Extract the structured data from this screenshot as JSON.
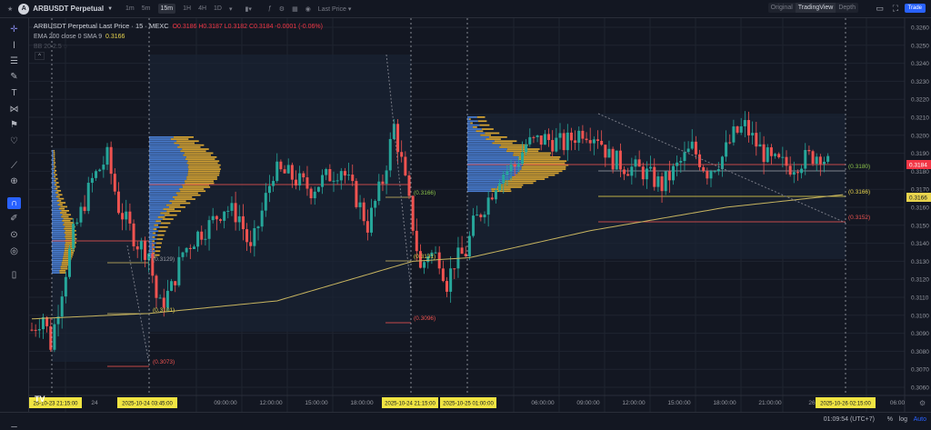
{
  "header": {
    "symbol": "ARBUSDT Perpetual",
    "intervals": [
      "1m",
      "5m",
      "15m",
      "1H",
      "4H",
      "1D"
    ],
    "selected_interval": "15m",
    "price_type": "Last Price ▾",
    "view_tabs": [
      "Original",
      "TradingView",
      "Depth"
    ],
    "selected_view": "TradingView",
    "trade_label": "Trade"
  },
  "legend": {
    "title": "ARBUSDT Perpetual Last Price · 15 · MEXC",
    "ohlc": "O0.3186 H0.3187 L0.3182 C0.3184 -0.0001 (-0.06%)",
    "ema_label": "EMA 200 close 0 SMA 9",
    "ema_value": "0.3166",
    "bb_label": "BB 20 2.5"
  },
  "price_axis": {
    "ticks": [
      "0.3260",
      "0.3250",
      "0.3240",
      "0.3230",
      "0.3220",
      "0.3210",
      "0.3200",
      "0.3190",
      "0.3180",
      "0.3170",
      "0.3160",
      "0.3150",
      "0.3140",
      "0.3130",
      "0.3120",
      "0.3110",
      "0.3100",
      "0.3090",
      "0.3080",
      "0.3070",
      "0.3060"
    ],
    "last_price": "0.3184",
    "ema_price": "0.3166",
    "last_color": "#f23645",
    "ema_color": "#e8d44d"
  },
  "time_axis": {
    "labels": [
      "24",
      "09:00:00",
      "12:00:00",
      "15:00:00",
      "18:00:00",
      "06:00:00",
      "09:00:00",
      "12:00:00",
      "15:00:00",
      "18:00:00",
      "21:00:00",
      "26",
      "06:00"
    ],
    "highlights": [
      "25-10-23  21:15:00",
      "2025-10-24  03:45:00",
      "2025-10-24  21:15:00",
      "2025-10-25  01:00:00",
      "2025-10-26  02:15:00"
    ]
  },
  "annotations": [
    "(0.3073)",
    "(0.3101)",
    "(0.3129)",
    "(0.3166)",
    "(0.3131)",
    "(0.3096)",
    "(0.3180)",
    "(0.3166)",
    "(0.3152)"
  ],
  "footer": {
    "clock": "01:09:54 (UTC+7)",
    "percent": "%",
    "log": "log",
    "auto": "Auto"
  },
  "colors": {
    "up": "#26a69a",
    "down": "#ef5350",
    "buy": "#4a7fd4",
    "sell": "#d9a632",
    "ema": "#c8b560"
  },
  "chart_data": {
    "type": "candlestick",
    "price_path": [
      [
        0,
        0.3092
      ],
      [
        3,
        0.31
      ],
      [
        5,
        0.3084
      ],
      [
        8,
        0.3115
      ],
      [
        11,
        0.3145
      ],
      [
        16,
        0.3175
      ],
      [
        20,
        0.3188
      ],
      [
        23,
        0.316
      ],
      [
        28,
        0.314
      ],
      [
        31,
        0.3135
      ],
      [
        33,
        0.311
      ],
      [
        34,
        0.3105
      ],
      [
        37,
        0.3115
      ],
      [
        40,
        0.3135
      ],
      [
        44,
        0.3145
      ],
      [
        47,
        0.315
      ],
      [
        51,
        0.316
      ],
      [
        55,
        0.3155
      ],
      [
        58,
        0.3135
      ],
      [
        62,
        0.3165
      ],
      [
        64,
        0.318
      ],
      [
        68,
        0.3178
      ],
      [
        74,
        0.317
      ],
      [
        77,
        0.3175
      ],
      [
        82,
        0.3182
      ],
      [
        86,
        0.3165
      ],
      [
        89,
        0.315
      ],
      [
        93,
        0.3175
      ],
      [
        96,
        0.3205
      ],
      [
        98,
        0.3185
      ],
      [
        101,
        0.315
      ],
      [
        103,
        0.3125
      ],
      [
        105,
        0.3135
      ],
      [
        108,
        0.3132
      ],
      [
        110,
        0.3118
      ],
      [
        112,
        0.313
      ],
      [
        115,
        0.3135
      ],
      [
        117,
        0.315
      ],
      [
        121,
        0.3165
      ],
      [
        124,
        0.3178
      ],
      [
        128,
        0.3183
      ],
      [
        131,
        0.3195
      ],
      [
        136,
        0.3198
      ],
      [
        141,
        0.3195
      ],
      [
        146,
        0.3203
      ],
      [
        150,
        0.32
      ],
      [
        153,
        0.3188
      ],
      [
        157,
        0.3183
      ],
      [
        162,
        0.318
      ],
      [
        167,
        0.3172
      ],
      [
        172,
        0.3185
      ],
      [
        175,
        0.3193
      ],
      [
        179,
        0.318
      ],
      [
        183,
        0.3188
      ],
      [
        186,
        0.32
      ],
      [
        189,
        0.3205
      ],
      [
        192,
        0.3195
      ],
      [
        196,
        0.3185
      ],
      [
        201,
        0.3183
      ],
      [
        206,
        0.3188
      ],
      [
        209,
        0.319
      ],
      [
        211,
        0.3184
      ]
    ],
    "ema_path": [
      [
        0,
        0.3098
      ],
      [
        31,
        0.3101
      ],
      [
        65,
        0.3108
      ],
      [
        101,
        0.313
      ],
      [
        116,
        0.3132
      ],
      [
        148,
        0.3147
      ],
      [
        184,
        0.316
      ],
      [
        215,
        0.3167
      ]
    ]
  }
}
